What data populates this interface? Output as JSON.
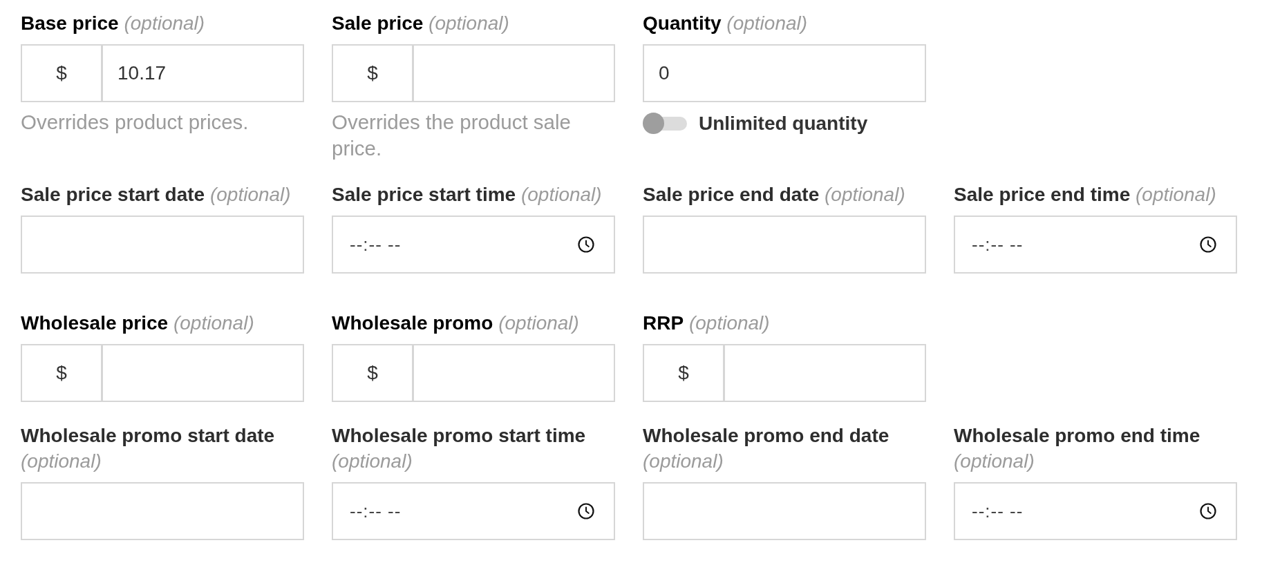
{
  "rows": [
    {
      "fields": [
        {
          "kind": "currency",
          "label": "Base price",
          "note": "(optional)",
          "prefix": "$",
          "value": "10.17",
          "help": "Overrides product prices."
        },
        {
          "kind": "currency",
          "label": "Sale price",
          "note": "(optional)",
          "prefix": "$",
          "help": "Overrides the product sale price."
        },
        {
          "kind": "number",
          "label": "Quantity",
          "note": "(optional)",
          "value": "0",
          "toggle": {
            "label": "Unlimited quantity",
            "on": false
          }
        }
      ]
    },
    {
      "fields": [
        {
          "kind": "date",
          "label": "Sale price start date",
          "note": "(optional)"
        },
        {
          "kind": "time",
          "label": "Sale price start time",
          "note": "(optional)",
          "placeholder": "--:-- --"
        },
        {
          "kind": "date",
          "label": "Sale price end date",
          "note": "(optional)"
        },
        {
          "kind": "time",
          "label": "Sale price end time",
          "note": "(optional)",
          "placeholder": "--:-- --"
        }
      ]
    },
    {
      "fields": [
        {
          "kind": "currency",
          "label": "Wholesale price",
          "note": "(optional)",
          "prefix": "$"
        },
        {
          "kind": "currency",
          "label": "Wholesale promo",
          "note": "(optional)",
          "prefix": "$"
        },
        {
          "kind": "currency",
          "label": "RRP",
          "note": "(optional)",
          "prefix": "$"
        }
      ]
    },
    {
      "fields": [
        {
          "kind": "date",
          "label": "Wholesale promo start date",
          "note": "(optional)"
        },
        {
          "kind": "time",
          "label": "Wholesale promo start time",
          "note": "(optional)",
          "placeholder": "--:-- --"
        },
        {
          "kind": "date",
          "label": "Wholesale promo end date",
          "note": "(optional)"
        },
        {
          "kind": "time",
          "label": "Wholesale promo end time",
          "note": "(optional)",
          "placeholder": "--:-- --"
        }
      ]
    }
  ]
}
